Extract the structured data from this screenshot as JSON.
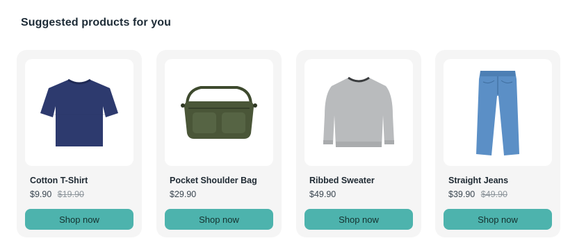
{
  "section": {
    "title": "Suggested products for you"
  },
  "products": [
    {
      "name": "Cotton T-Shirt",
      "price": "$9.90",
      "old_price": "$19.90",
      "button_label": "Shop now",
      "image_icon": "tshirt-icon",
      "image_color": "#2d3a6e"
    },
    {
      "name": "Pocket Shoulder Bag",
      "price": "$29.90",
      "old_price": "",
      "button_label": "Shop now",
      "image_icon": "shoulder-bag-icon",
      "image_color": "#4a5638"
    },
    {
      "name": "Ribbed Sweater",
      "price": "$49.90",
      "old_price": "",
      "button_label": "Shop now",
      "image_icon": "sweater-icon",
      "image_color": "#b9bbbd"
    },
    {
      "name": "Straight Jeans",
      "price": "$39.90",
      "old_price": "$49.90",
      "button_label": "Shop now",
      "image_icon": "jeans-icon",
      "image_color": "#5b8fc6"
    }
  ],
  "colors": {
    "accent": "#4db3ad",
    "card_bg": "#f5f5f5"
  }
}
